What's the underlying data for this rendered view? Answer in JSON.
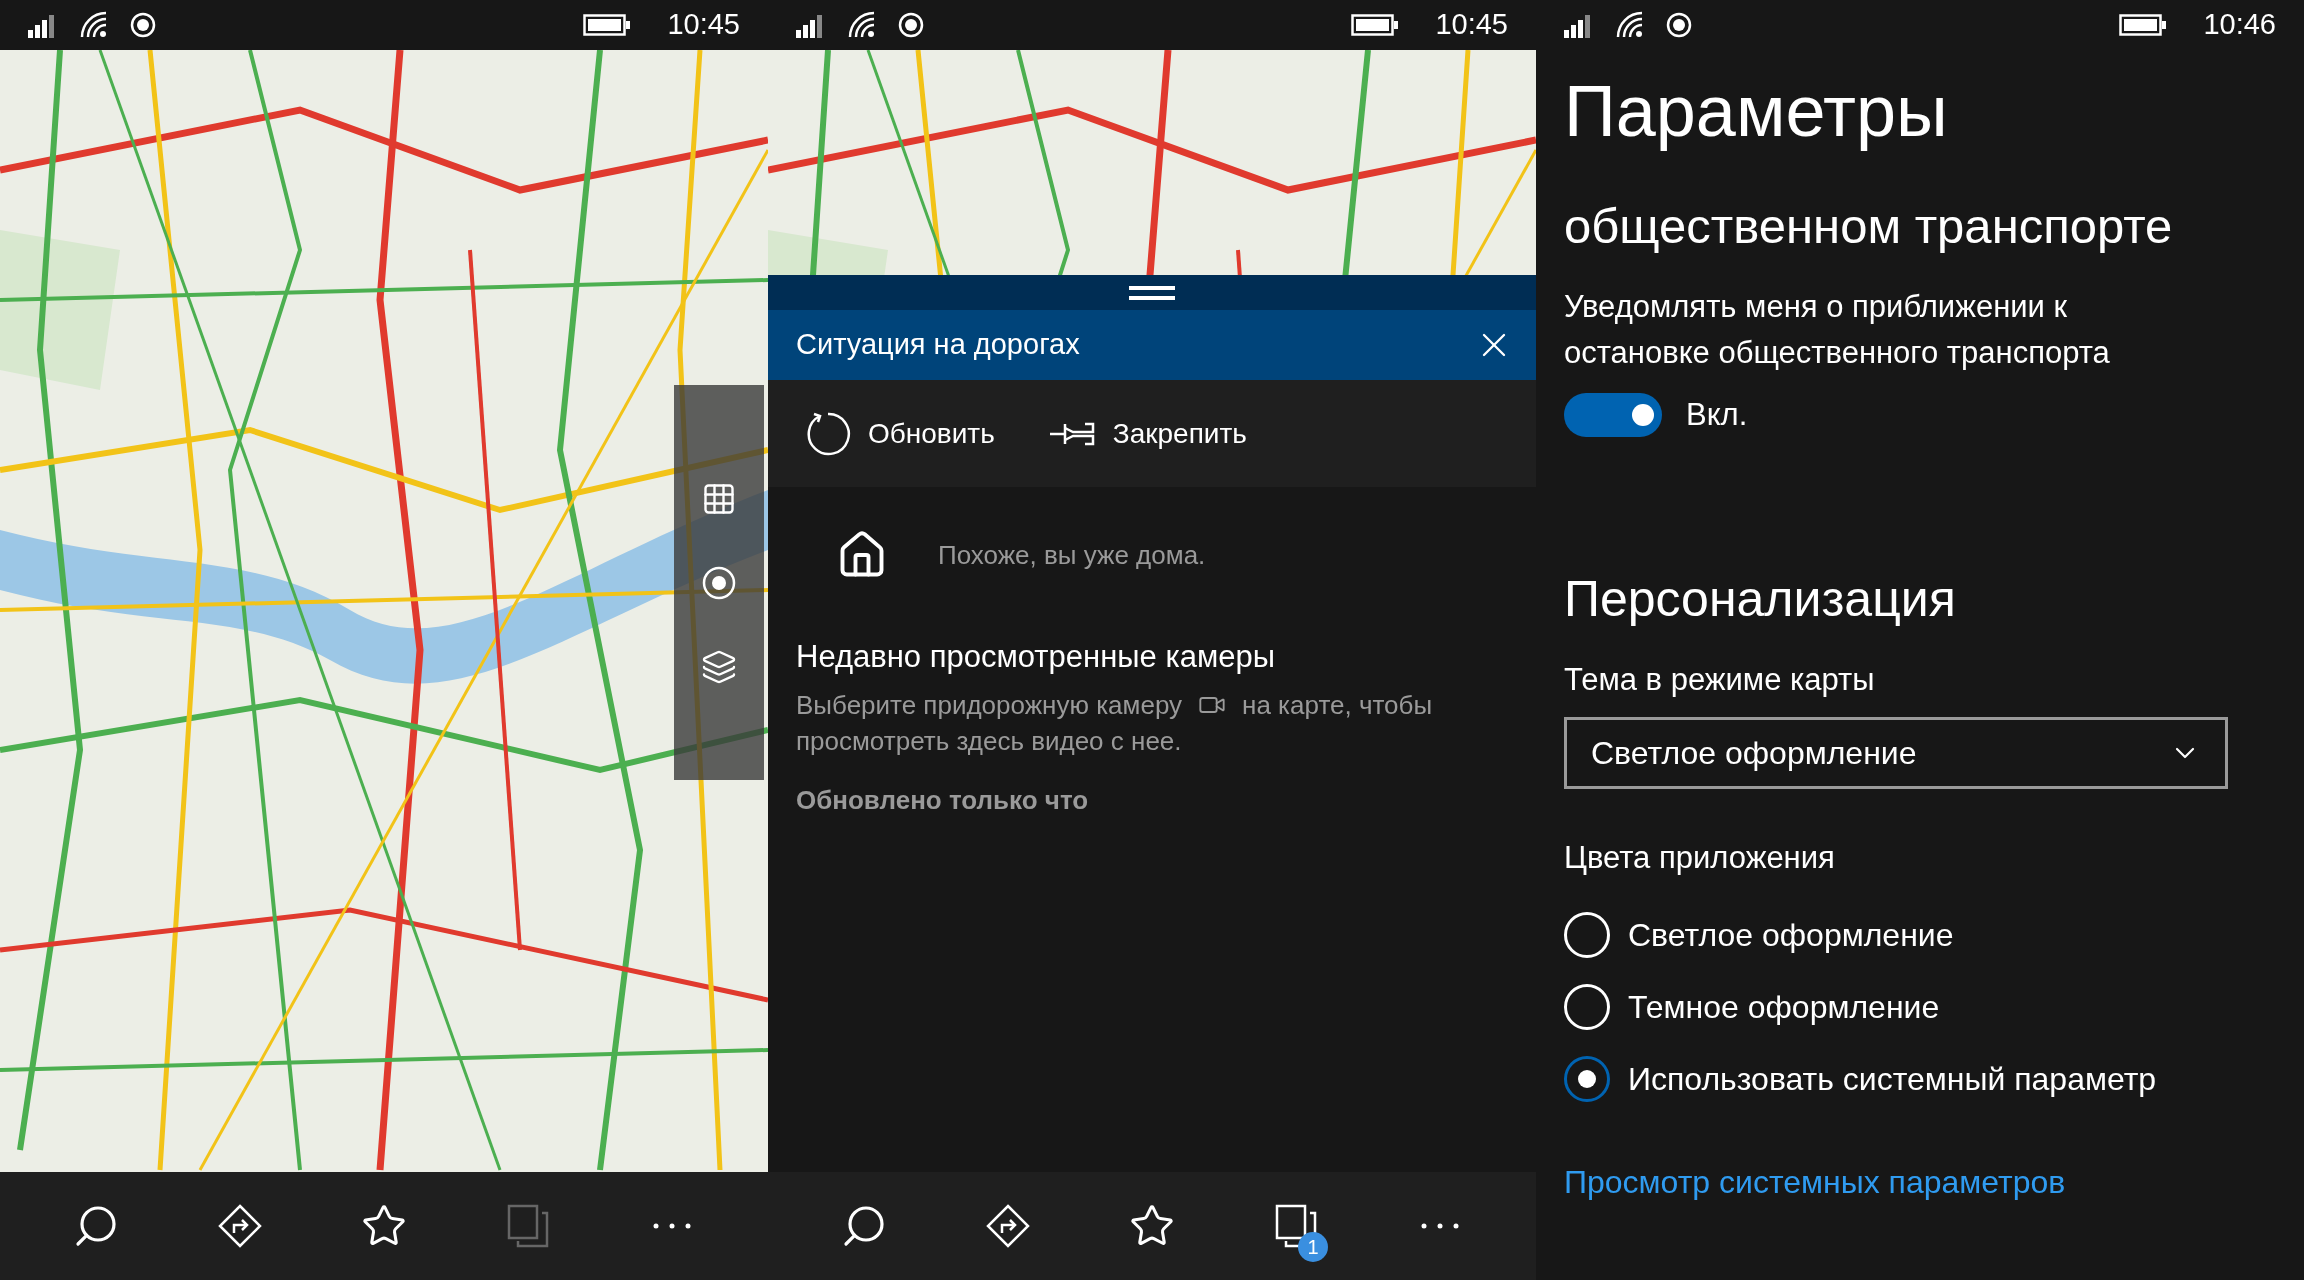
{
  "map_screen": {
    "status_bar": {
      "time": "10:45"
    },
    "map_controls": [
      {
        "kind": "grid"
      },
      {
        "kind": "locate"
      },
      {
        "kind": "layers"
      }
    ],
    "app_bar": [
      {
        "kind": "search",
        "disabled": false
      },
      {
        "kind": "directions",
        "disabled": false
      },
      {
        "kind": "favorites",
        "disabled": false
      },
      {
        "kind": "tabs",
        "disabled": true
      },
      {
        "kind": "more",
        "disabled": false
      }
    ]
  },
  "traffic_screen": {
    "status_bar": {
      "time": "10:45"
    },
    "panel_title": "Ситуация на дорогах",
    "actions": [
      {
        "kind": "refresh",
        "label": "Обновить"
      },
      {
        "kind": "pin",
        "label": "Закрепить"
      }
    ],
    "home_message": "Похоже, вы уже дома.",
    "cameras_heading": "Недавно просмотренные камеры",
    "cameras_hint_before": "Выберите придорожную камеру",
    "cameras_hint_after": "на карте, чтобы",
    "cameras_hint_line2": "просмотреть здесь видео с нее.",
    "updated": "Обновлено только что",
    "app_bar": [
      {
        "kind": "search",
        "disabled": false
      },
      {
        "kind": "directions",
        "disabled": false
      },
      {
        "kind": "favorites",
        "disabled": false
      },
      {
        "kind": "tabs",
        "disabled": false,
        "badge": "1"
      },
      {
        "kind": "more",
        "disabled": false
      }
    ]
  },
  "settings_screen": {
    "status_bar": {
      "time": "10:46"
    },
    "title": "Параметры",
    "subtitle": "общественном транспорте",
    "notify_label": "Уведомлять меня о приближении к остановке общественного транспорта",
    "notify_toggle": {
      "on": true,
      "state_text": "Вкл."
    },
    "section": "Персонализация",
    "map_theme": {
      "label": "Тема в режиме карты",
      "value": "Светлое оформление"
    },
    "app_colors": {
      "label": "Цвета приложения",
      "options": [
        {
          "label": "Светлое оформление",
          "selected": false
        },
        {
          "label": "Темное оформление",
          "selected": false
        },
        {
          "label": "Использовать системный параметр",
          "selected": true
        }
      ]
    },
    "link": "Просмотр системных параметров"
  }
}
